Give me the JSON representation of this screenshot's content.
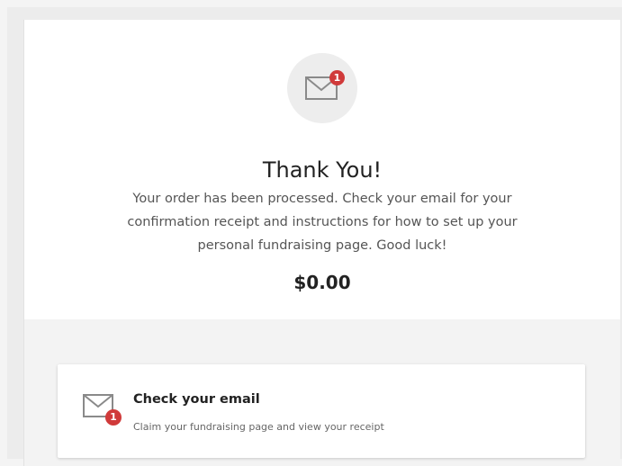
{
  "hero": {
    "icon": "envelope-icon",
    "badge_count": "1",
    "title": "Thank You!",
    "message": "Your order has been processed. Check your email for your confirmation receipt and instructions for how to set up your personal fundraising page. Good luck!",
    "amount": "$0.00"
  },
  "next_step": {
    "icon": "envelope-icon",
    "badge_count": "1",
    "title": "Check your email",
    "description": "Claim your fundraising page and view your receipt"
  },
  "colors": {
    "badge": "#d03a3a",
    "icon_stroke": "#8a8a8a",
    "icon_circle_bg": "#ededed",
    "band_bg": "#f3f3f3"
  }
}
